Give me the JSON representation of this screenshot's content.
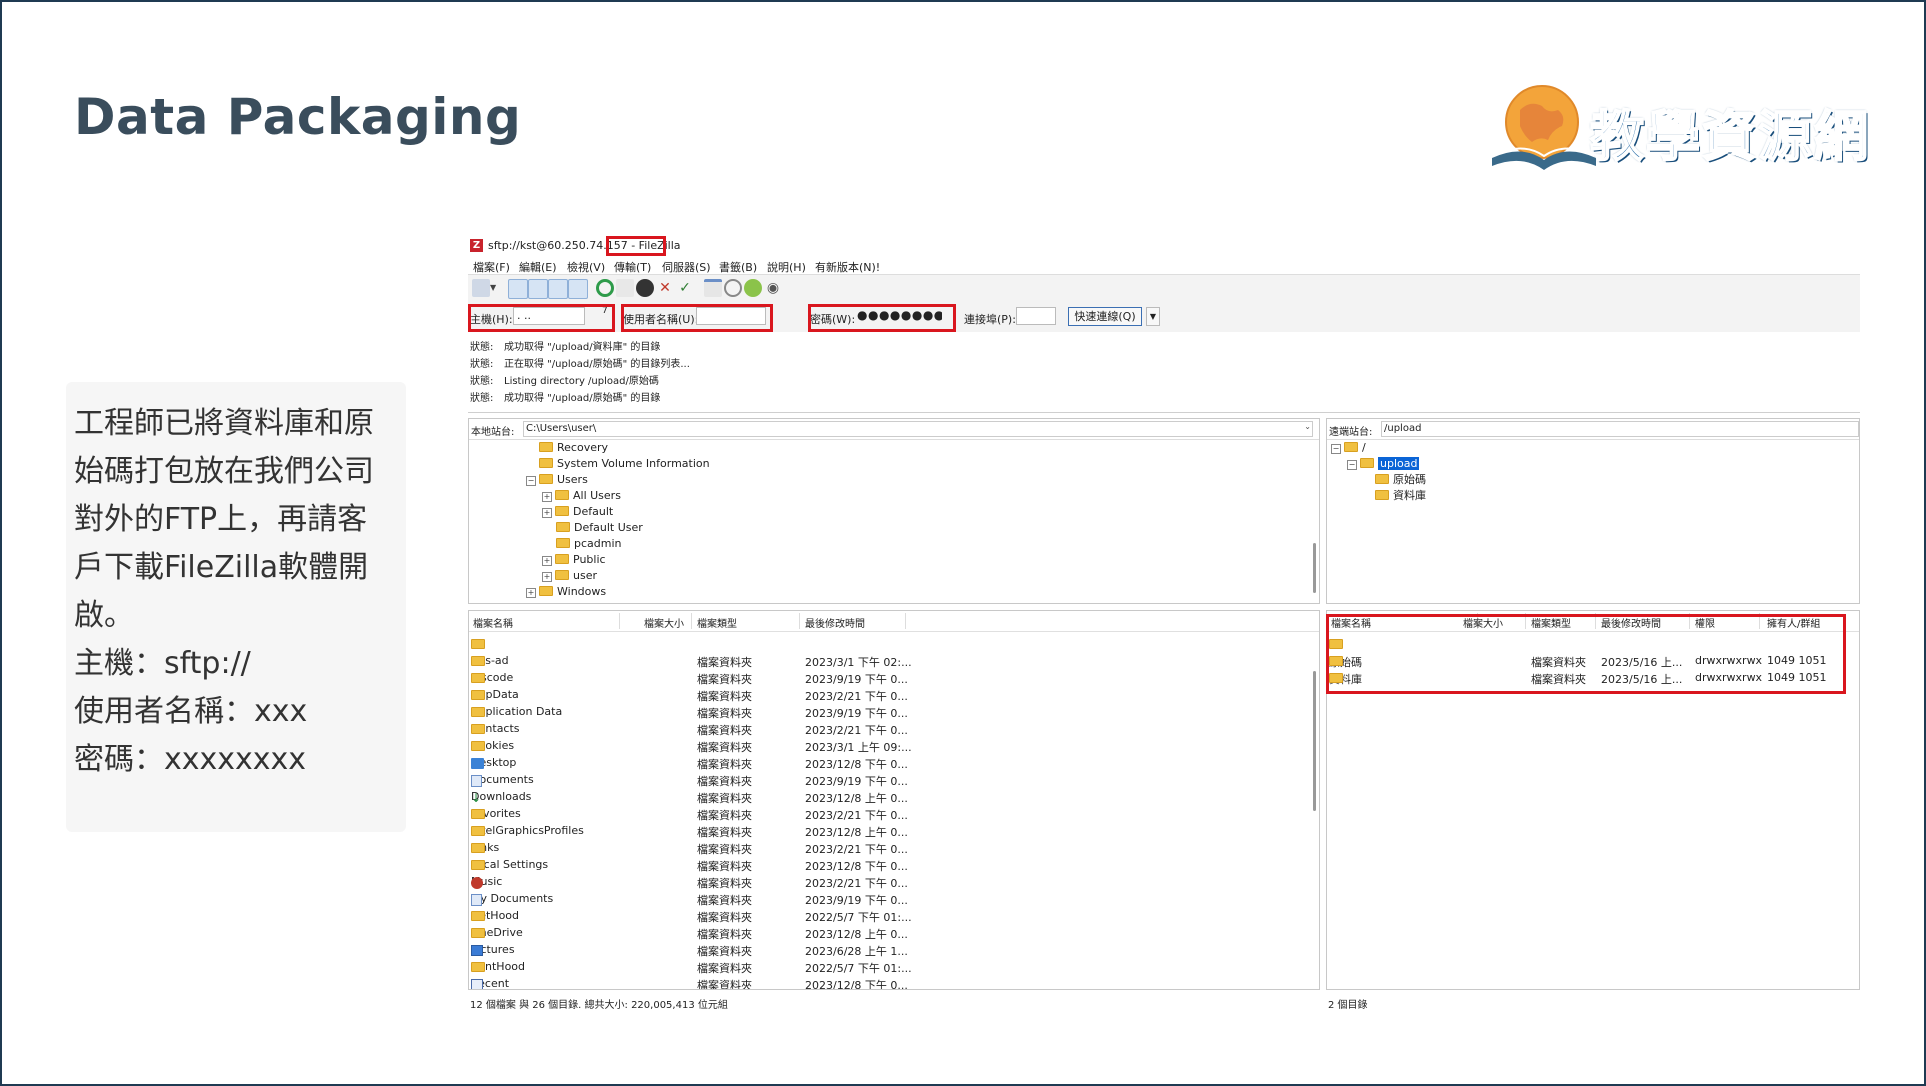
{
  "slide": {
    "title": "Data Packaging",
    "logo_text": "教學資源網",
    "body_lines": [
      "工程師已將資料庫和原",
      "始碼打包放在我們公司",
      "對外的FTP上，再請客",
      "戶下載FileZilla軟體開",
      "啟。",
      "主機：sftp://",
      "使用者名稱：xxx",
      "密碼：xxxxxxxx"
    ]
  },
  "filezilla": {
    "window_title": "sftp://kst@60.250.74.157",
    "window_app": " - FileZilla",
    "menu": [
      "檔案(F)",
      "編輯(E)",
      "檢視(V)",
      "傳輸(T)",
      "伺服器(S)",
      "書籤(B)",
      "說明(H)",
      "有新版本(N)!"
    ],
    "quickconnect": {
      "host_label": "主機(H):",
      "host_value": ". ..",
      "host_tail": "7",
      "user_label": "使用者名稱(U):",
      "user_value": "",
      "pass_label": "密碼(W):",
      "pass_value": "●●●●●●●●",
      "port_label": "連接埠(P):",
      "port_value": "",
      "connect_button": "快速連線(Q)",
      "dropdown_arrow": "▼"
    },
    "log": [
      {
        "k": "狀態:",
        "v": "成功取得 \"/upload/資料庫\" 的目錄"
      },
      {
        "k": "狀態:",
        "v": "正在取得 \"/upload/原始碼\" 的目錄列表..."
      },
      {
        "k": "狀態:",
        "v": "Listing directory /upload/原始碼"
      },
      {
        "k": "狀態:",
        "v": "成功取得 \"/upload/原始碼\" 的目錄"
      }
    ],
    "local": {
      "site_label": "本地站台:",
      "site_path": "C:\\Users\\user\\",
      "tree": [
        {
          "name": "Recovery",
          "level": 1,
          "exp": ""
        },
        {
          "name": "System Volume Information",
          "level": 1,
          "exp": ""
        },
        {
          "name": "Users",
          "level": 1,
          "exp": "−"
        },
        {
          "name": "All Users",
          "level": 2,
          "exp": "+"
        },
        {
          "name": "Default",
          "level": 2,
          "exp": "+"
        },
        {
          "name": "Default User",
          "level": 2,
          "exp": ""
        },
        {
          "name": "pcadmin",
          "level": 2,
          "exp": ""
        },
        {
          "name": "Public",
          "level": 2,
          "exp": "+"
        },
        {
          "name": "user",
          "level": 2,
          "exp": "+"
        },
        {
          "name": "Windows",
          "level": 1,
          "exp": "+"
        }
      ],
      "columns": [
        "檔案名稱",
        "檔案大小",
        "檔案類型",
        "最後修改時間"
      ],
      "files": [
        {
          "name": "..",
          "type": "",
          "date": "",
          "icon": "folder"
        },
        {
          "name": ".ms-ad",
          "type": "檔案資料夾",
          "date": "2023/3/1 下午 02:...",
          "icon": "folder"
        },
        {
          "name": ".vscode",
          "type": "檔案資料夾",
          "date": "2023/9/19 下午 0...",
          "icon": "folder"
        },
        {
          "name": "AppData",
          "type": "檔案資料夾",
          "date": "2023/2/21 下午 0...",
          "icon": "folder"
        },
        {
          "name": "Application Data",
          "type": "檔案資料夾",
          "date": "2023/9/19 下午 0...",
          "icon": "folder"
        },
        {
          "name": "Contacts",
          "type": "檔案資料夾",
          "date": "2023/2/21 下午 0...",
          "icon": "folder"
        },
        {
          "name": "Cookies",
          "type": "檔案資料夾",
          "date": "2023/3/1 上午 09:...",
          "icon": "folder"
        },
        {
          "name": "Desktop",
          "type": "檔案資料夾",
          "date": "2023/12/8 下午 0...",
          "icon": "desk"
        },
        {
          "name": "Documents",
          "type": "檔案資料夾",
          "date": "2023/9/19 下午 0...",
          "icon": "doc"
        },
        {
          "name": "Downloads",
          "type": "檔案資料夾",
          "date": "2023/12/8 上午 0...",
          "icon": "dl"
        },
        {
          "name": "Favorites",
          "type": "檔案資料夾",
          "date": "2023/2/21 下午 0...",
          "icon": "folder"
        },
        {
          "name": "IntelGraphicsProfiles",
          "type": "檔案資料夾",
          "date": "2023/12/8 上午 0...",
          "icon": "folder"
        },
        {
          "name": "Links",
          "type": "檔案資料夾",
          "date": "2023/2/21 下午 0...",
          "icon": "folder"
        },
        {
          "name": "Local Settings",
          "type": "檔案資料夾",
          "date": "2023/12/8 下午 0...",
          "icon": "folder"
        },
        {
          "name": "Music",
          "type": "檔案資料夾",
          "date": "2023/2/21 下午 0...",
          "icon": "music"
        },
        {
          "name": "My Documents",
          "type": "檔案資料夾",
          "date": "2023/9/19 下午 0...",
          "icon": "doc"
        },
        {
          "name": "NetHood",
          "type": "檔案資料夾",
          "date": "2022/5/7 下午 01:...",
          "icon": "folder"
        },
        {
          "name": "OneDrive",
          "type": "檔案資料夾",
          "date": "2023/12/8 上午 0...",
          "icon": "folder"
        },
        {
          "name": "Pictures",
          "type": "檔案資料夾",
          "date": "2023/6/28 上午 1...",
          "icon": "pic"
        },
        {
          "name": "PrintHood",
          "type": "檔案資料夾",
          "date": "2022/5/7 下午 01:...",
          "icon": "folder"
        },
        {
          "name": "Recent",
          "type": "檔案資料夾",
          "date": "2023/12/8 下午 0...",
          "icon": "recent"
        }
      ],
      "status": "12 個檔案 與 26 個目錄. 總共大小: 220,005,413 位元組"
    },
    "remote": {
      "site_label": "遠端站台:",
      "site_path": "/upload",
      "tree": [
        {
          "name": "/",
          "level": 0,
          "exp": "−"
        },
        {
          "name": "upload",
          "level": 1,
          "exp": "−",
          "selected": true
        },
        {
          "name": "原始碼",
          "level": 2,
          "exp": ""
        },
        {
          "name": "資料庫",
          "level": 2,
          "exp": ""
        }
      ],
      "columns": [
        "檔案名稱",
        "檔案大小",
        "檔案類型",
        "最後修改時間",
        "權限",
        "擁有人/群組"
      ],
      "files": [
        {
          "name": "..",
          "type": "",
          "date": "",
          "perm": "",
          "owner": ""
        },
        {
          "name": "原始碼",
          "type": "檔案資料夾",
          "date": "2023/5/16 上...",
          "perm": "drwxrwxrwx",
          "owner": "1049 1051"
        },
        {
          "name": "資料庫",
          "type": "檔案資料夾",
          "date": "2023/5/16 上...",
          "perm": "drwxrwxrwx",
          "owner": "1049 1051"
        }
      ],
      "status": "2 個目錄"
    },
    "colors": {
      "highlight": "#d9161e",
      "selection": "#0a64d6",
      "folder": "#f0c040"
    }
  }
}
